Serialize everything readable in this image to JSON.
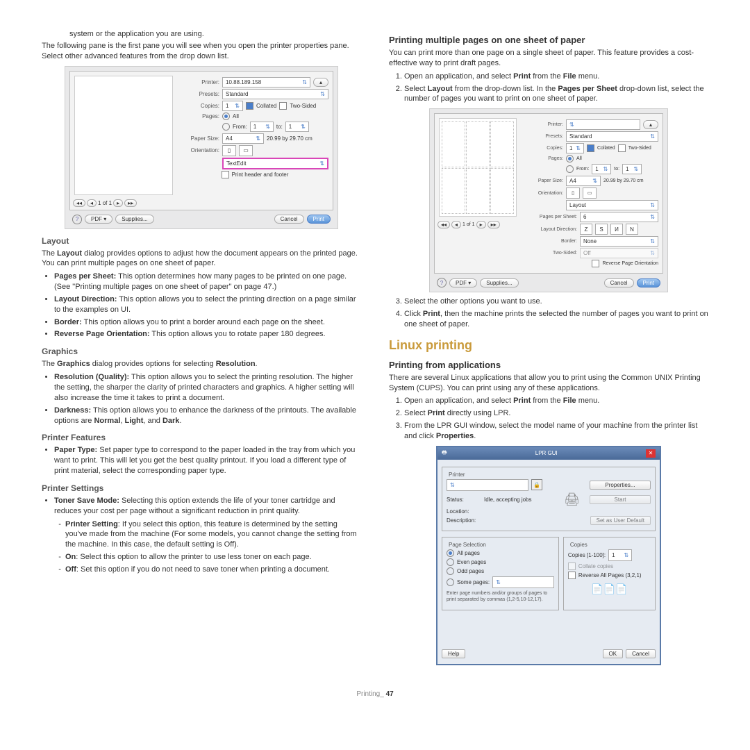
{
  "left": {
    "intro1": "system or the application you are using.",
    "intro2": "The following pane is the first pane you will see when you open the printer properties pane. Select other advanced features from the drop down list.",
    "layout": {
      "h": "Layout",
      "p": "The Layout dialog provides options to adjust how the document appears on the printed page. You can print multiple pages on one sheet of paper.",
      "i1a": "Pages per Sheet:",
      "i1b": "  This option determines how many pages to be printed on one page. (See \"Printing multiple pages on one sheet of paper\" on page 47.)",
      "i2a": "Layout Direction:",
      "i2b": "  This option allows you to select the printing direction on a page similar to the examples on UI.",
      "i3a": "Border:",
      "i3b": "  This option allows you to print a border around each page on the sheet.",
      "i4a": "Reverse Page Orientation:",
      "i4b": "  This option allows you to rotate paper 180 degrees."
    },
    "graphics": {
      "h": "Graphics",
      "p1a": "The ",
      "p1b": "Graphics",
      "p1c": " dialog provides options for selecting ",
      "p1d": "Resolution",
      "p1e": ".",
      "i1a": "Resolution (Quality):",
      "i1b": "  This option allows you to select the printing resolution. The higher the setting, the sharper the clarity of printed characters and graphics. A higher setting will also increase the time it takes to print a document.",
      "i2a": "Darkness:",
      "i2b": "  This option allows you to enhance the darkness of the printouts. The available options are ",
      "i2c": "Normal",
      "i2d": ", ",
      "i2e": "Light",
      "i2f": ", and ",
      "i2g": "Dark",
      "i2h": "."
    },
    "pf": {
      "h": "Printer Features",
      "i1a": "Paper Type:",
      "i1b": "  Set paper type to correspond to the paper loaded in the tray from which you want to print. This will let you get the best quality printout. If you load a different type of print material, select the corresponding paper type."
    },
    "ps": {
      "h": "Printer Settings",
      "i1a": "Toner Save Mode:",
      "i1b": "  Selecting this option extends the life of your toner cartridge and reduces your cost per page without a significant reduction in print quality.",
      "s1a": "Printer Setting",
      "s1b": ": If you select this option, this feature is determined by the setting you've made from the machine (For some models, you cannot change the setting from the machine. In this case, the default setting is Off).",
      "s2a": "On",
      "s2b": ": Select this option to allow the printer to use less toner on each page.",
      "s3a": "Off",
      "s3b": ": Set this option if you do not need to save toner when printing a document."
    }
  },
  "right": {
    "mp": {
      "h": "Printing multiple pages on one sheet of paper",
      "p": "You can print more than one page on a single sheet of paper. This feature provides a cost-effective way to print draft pages.",
      "o1a": "Open an application, and select ",
      "o1b": "Print",
      "o1c": " from the ",
      "o1d": "File",
      "o1e": " menu.",
      "o2a": "Select ",
      "o2b": "Layout",
      "o2c": " from the drop-down list. In the ",
      "o2d": "Pages per Sheet",
      "o2e": " drop-down list, select the number of pages you want to print on one sheet of paper.",
      "o3": "Select the other options you want to use.",
      "o4a": "Click ",
      "o4b": "Print",
      "o4c": ", then the machine prints the selected the number of pages you want to print on one sheet of paper."
    },
    "lp": {
      "h": "Linux printing",
      "h2": "Printing from applications",
      "p": "There are several Linux applications that allow you to print using the Common UNIX Printing System (CUPS). You can print using any of these applications.",
      "o1a": "Open an application, and select ",
      "o1b": "Print",
      "o1c": " from the ",
      "o1d": "File",
      "o1e": " menu.",
      "o2a": "Select ",
      "o2b": "Print",
      "o2c": " directly using LPR.",
      "o3a": "From the LPR GUI window, select the model name of your machine from the printer list and click ",
      "o3b": "Properties",
      "o3c": "."
    }
  },
  "dlg": {
    "printer": "10.88.189.158",
    "presets": "Standard",
    "copies": "1",
    "collated": "Collated",
    "twosided": "Two-Sided",
    "pages": "Pages:",
    "all": "All",
    "from": "From:",
    "fromv": "1",
    "to": "to:",
    "tov": "1",
    "papersize": "Paper Size:",
    "a4": "A4",
    "dims": "20.99 by 29.70 cm",
    "orient": "Orientation:",
    "textedit": "TextEdit",
    "phf": "Print header and footer",
    "layout": "Layout",
    "pps": "Pages per Sheet:",
    "ppsv": "6",
    "ldir": "Layout Direction:",
    "border": "Border:",
    "none": "None",
    "ts": "Two-Sided:",
    "off": "Off",
    "rpo": "Reverse Page Orientation",
    "pdf": "PDF ▾",
    "supplies": "Supplies...",
    "cancel": "Cancel",
    "print": "Print",
    "oneofone": "1 of 1",
    "lprinter": "Printer:",
    "lpresets": "Presets:",
    "lcopies": "Copies:"
  },
  "lpr": {
    "title": "LPR GUI",
    "printer": "Printer",
    "status": "Status:",
    "statusv": "Idle, accepting jobs",
    "location": "Location:",
    "desc": "Description:",
    "props": "Properties...",
    "start": "Start",
    "sud": "Set as User Default",
    "psel": "Page Selection",
    "all": "All pages",
    "even": "Even pages",
    "odd": "Odd pages",
    "some": "Some pages:",
    "hint": "Enter page numbers and/or groups of pages to print separated by commas (1,2-5,10-12,17).",
    "copies": "Copies",
    "cpl": "Copies [1-100]:",
    "cpv": "1",
    "collate": "Collate copies",
    "rev": "Reverse All Pages (3,2,1)",
    "help": "Help",
    "ok": "OK",
    "cancel": "Cancel"
  },
  "footer": {
    "a": "Printing_ ",
    "b": "47"
  }
}
